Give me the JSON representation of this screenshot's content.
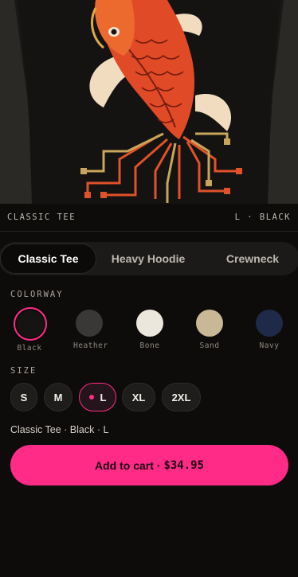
{
  "product": {
    "caption_name": "CLASSIC TEE",
    "caption_variant": "L · BLACK"
  },
  "product_tabs": [
    {
      "label": "Classic Tee",
      "active": true
    },
    {
      "label": "Heavy Hoodie",
      "active": false
    },
    {
      "label": "Crewneck",
      "active": false
    }
  ],
  "colorway": {
    "label": "COLORWAY",
    "selected": "Black",
    "options": [
      {
        "name": "Black",
        "color": "#161413"
      },
      {
        "name": "Heather",
        "color": "#3a3836"
      },
      {
        "name": "Bone",
        "color": "#ece7dd"
      },
      {
        "name": "Sand",
        "color": "#c9b896"
      },
      {
        "name": "Navy",
        "color": "#1f2a48"
      }
    ]
  },
  "size": {
    "label": "SIZE",
    "selected": "L",
    "options": [
      "S",
      "M",
      "L",
      "XL",
      "2XL"
    ]
  },
  "summary": "Classic Tee · Black · L",
  "cart": {
    "label": "Add to cart ·",
    "price": "$34.95"
  },
  "colors": {
    "accent": "#ff2b86",
    "background": "#0e0c0b"
  }
}
